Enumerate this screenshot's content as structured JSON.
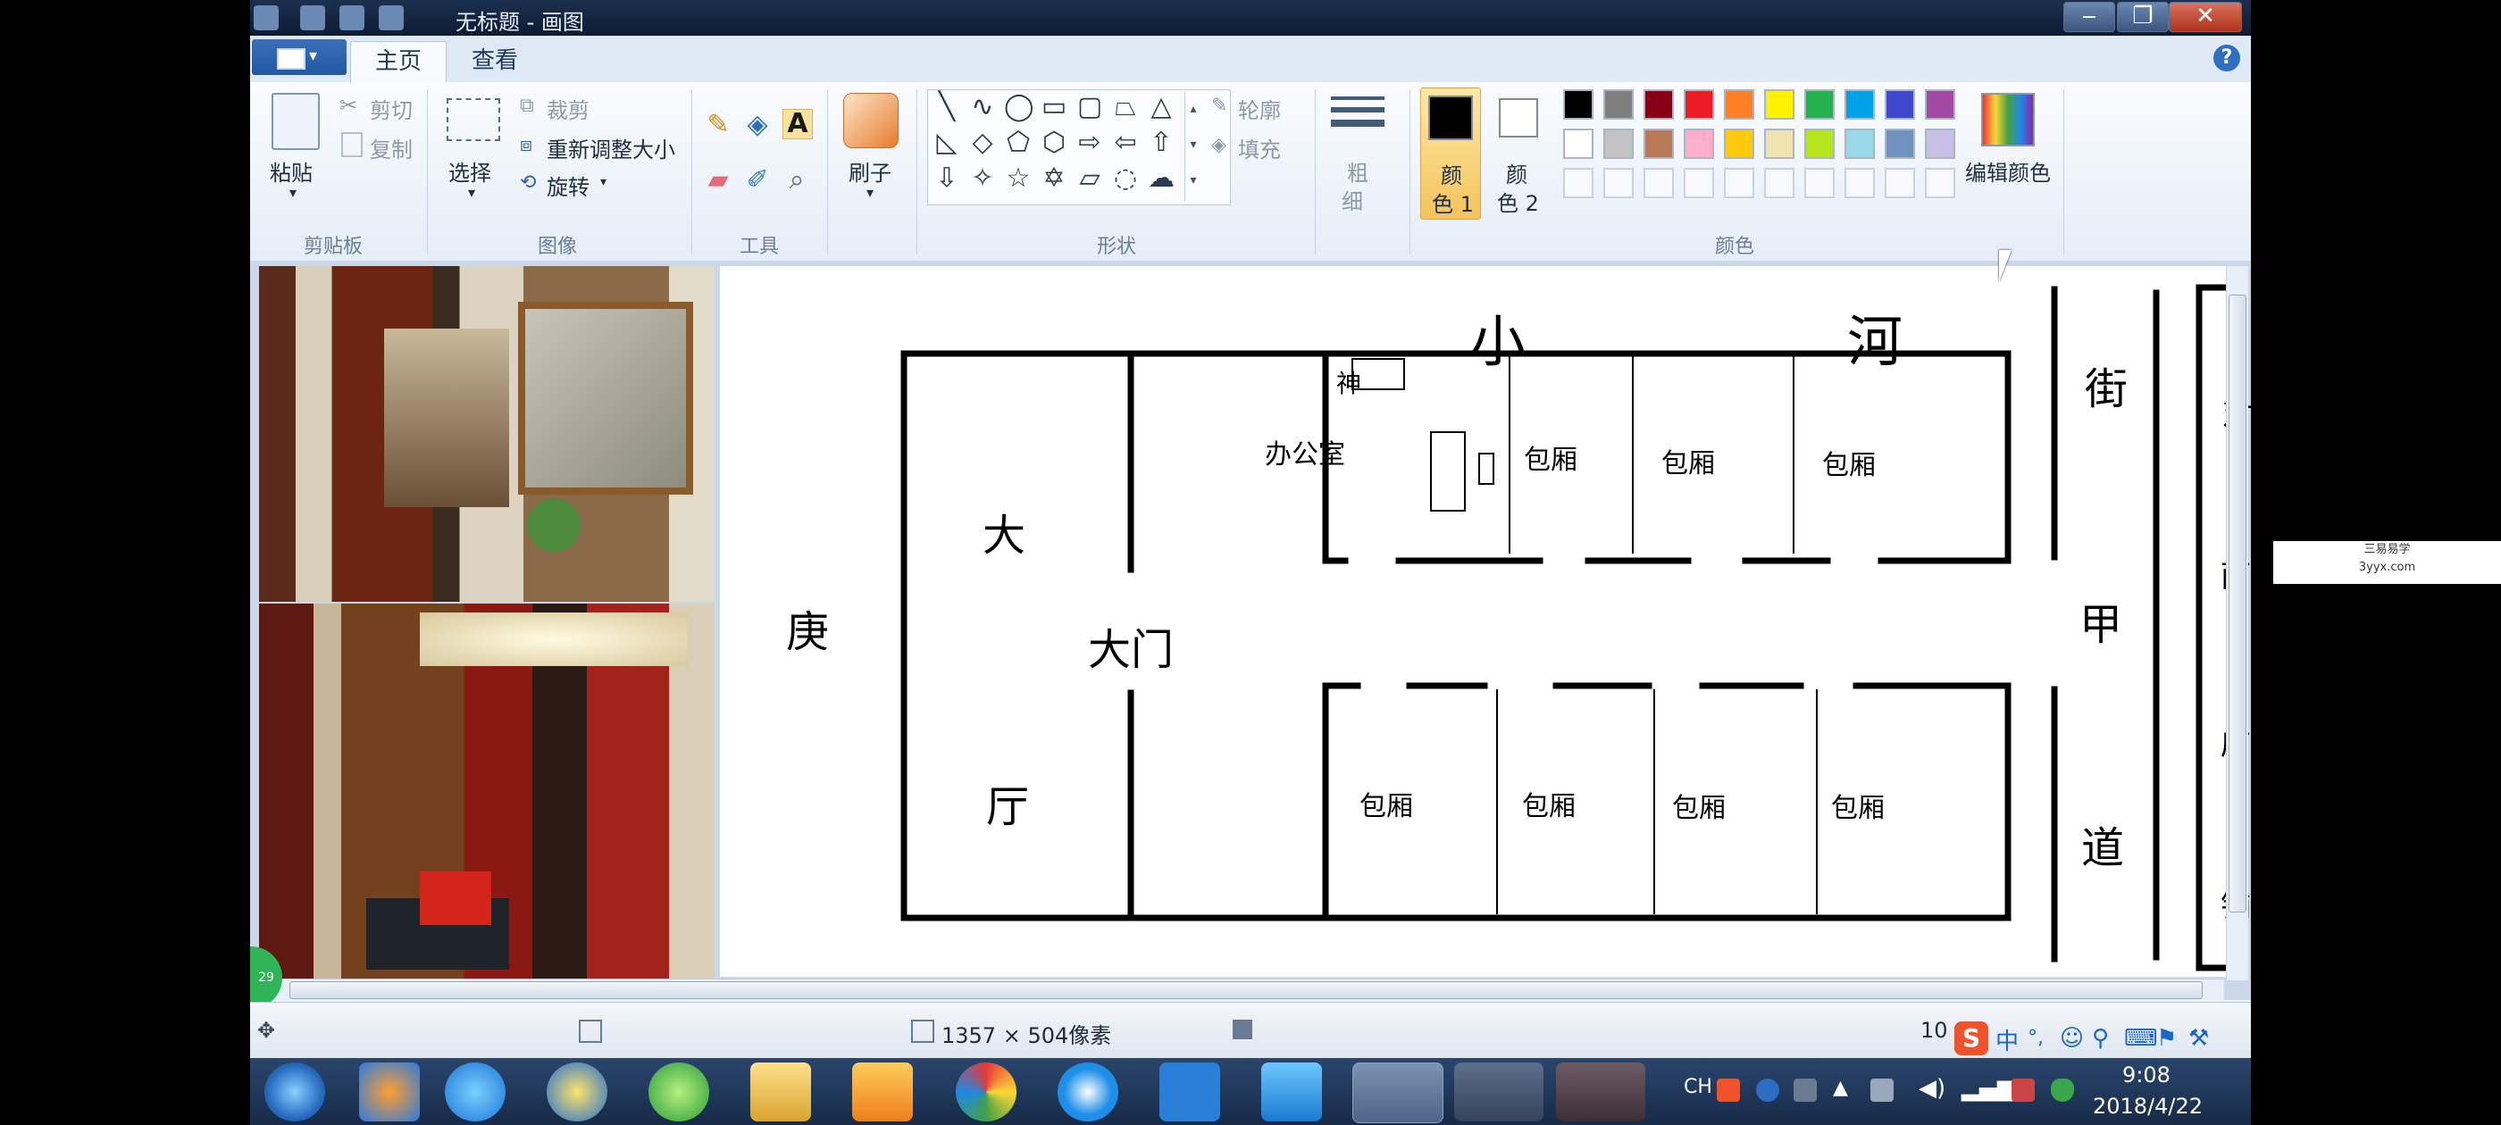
{
  "window": {
    "title": "无标题 - 画图",
    "controls": {
      "minimize": "‒",
      "maximize": "❐",
      "close": "✕"
    }
  },
  "ribbon": {
    "tabs": [
      "主页",
      "查看"
    ],
    "active_tab": "主页",
    "clipboard": {
      "paste": "粘贴",
      "cut": "剪切",
      "copy": "复制",
      "label": "剪贴板"
    },
    "image": {
      "select": "选择",
      "crop": "裁剪",
      "resize": "重新调整大小",
      "rotate": "旋转",
      "label": "图像"
    },
    "tools": {
      "label": "工具"
    },
    "brushes": {
      "label": "刷子"
    },
    "shapes": {
      "outline": "轮廓",
      "fill": "填充",
      "label": "形状"
    },
    "size": {
      "line1": "粗",
      "line2": "细"
    },
    "color1": {
      "line1": "颜",
      "line2": "色 1"
    },
    "color2": {
      "line1": "颜",
      "line2": "色 2"
    },
    "edit_colors": "编辑颜色",
    "colors_label": "颜色",
    "palette_row1": [
      "#000000",
      "#7f7f7f",
      "#880015",
      "#ed1c24",
      "#ff7f27",
      "#fff200",
      "#22b14c",
      "#00a2e8",
      "#3f48cc",
      "#a349a4"
    ],
    "palette_row2": [
      "#ffffff",
      "#c3c3c3",
      "#b97a57",
      "#ffaec9",
      "#ffc90e",
      "#efe4b0",
      "#b5e61d",
      "#99d9ea",
      "#7092be",
      "#c8bfe7"
    ]
  },
  "floorplan": {
    "top_river": [
      "小",
      "河"
    ],
    "west": "庚",
    "hall": [
      "大",
      "厅"
    ],
    "main_door": "大门",
    "shrine": "神",
    "office": "办公室",
    "private_room": "包厢",
    "street": [
      "街",
      "甲",
      "道"
    ],
    "opposite_shop": [
      "对",
      "面",
      "店",
      "铺"
    ]
  },
  "status": {
    "canvas_size": "1357 × 504像素",
    "zoom": "10"
  },
  "watermark": {
    "line1": "三易易学",
    "line2": "3yyx.com"
  },
  "taskbar": {
    "lang": "CH",
    "time": "9:08",
    "date": "2018/4/22",
    "ime_badge": "S",
    "ime_mode": "中"
  }
}
